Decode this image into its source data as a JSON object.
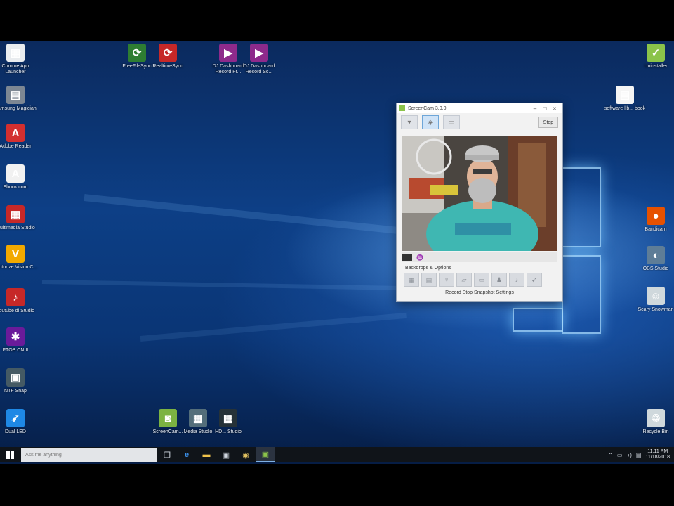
{
  "desktop": {
    "left_icons": [
      {
        "label": "Chrome App Launcher",
        "icon": "app-launcher-icon",
        "color": "#e9ecef"
      },
      {
        "label": "Samsung Magician",
        "icon": "drive-icon",
        "color": "#7d8793"
      },
      {
        "label": "Adobe Reader",
        "icon": "acrobat-icon",
        "color": "#d32f2f"
      },
      {
        "label": "Ebook.com",
        "icon": "pdf-icon",
        "color": "#f1f1f1"
      },
      {
        "label": "Multimedia Studio",
        "icon": "multimedia-icon",
        "color": "#c62828"
      },
      {
        "label": "Vectorize Vision C...",
        "icon": "v-logo-icon",
        "color": "#f2a900"
      },
      {
        "label": "youtube dl Studio",
        "icon": "youtube-icon",
        "color": "#c62828"
      },
      {
        "label": "FTOB CN II",
        "icon": "media-icon",
        "color": "#6a1b9a"
      },
      {
        "label": "NTF Snap",
        "icon": "screen-icon",
        "color": "#455a64"
      },
      {
        "label": "Dual LED",
        "icon": "wing-icon",
        "color": "#1e88e5"
      }
    ],
    "top_icons": [
      {
        "label": "FreeFileSync",
        "icon": "sync-green-icon",
        "color": "#2e7d32"
      },
      {
        "label": "RealtimeSync",
        "icon": "sync-red-icon",
        "color": "#c62828"
      },
      {
        "label": "DJ Dashboard Record Fr...",
        "icon": "video-folder-icon",
        "color": "#8e2a8b"
      },
      {
        "label": "DJ Dashboard Record Sc...",
        "icon": "video-folder-icon",
        "color": "#8e2a8b"
      }
    ],
    "right_icons": [
      {
        "label": "Uninstaller",
        "icon": "uninstall-icon",
        "color": "#8bc34a"
      },
      {
        "label": "software lib... book",
        "icon": "document-icon",
        "color": "#f5f5f5"
      },
      {
        "label": "Bandicam",
        "icon": "bandicam-icon",
        "color": "#e65100"
      },
      {
        "label": "OBS Studio",
        "icon": "globe-icon",
        "color": "#5e7d97"
      },
      {
        "label": "Scary Snowman",
        "icon": "alien-icon",
        "color": "#cfd8dc"
      },
      {
        "label": "Recycle Bin",
        "icon": "recycle-bin-icon",
        "color": "#cfd8dc"
      }
    ],
    "bottom_icons": [
      {
        "label": "ScreenCam...",
        "icon": "camera-green-icon",
        "color": "#7cb342"
      },
      {
        "label": "Media Studio",
        "icon": "clapper-icon",
        "color": "#546e7a"
      },
      {
        "label": "HD... Studio",
        "icon": "clapper-icon",
        "color": "#263238"
      }
    ]
  },
  "app_window": {
    "title": "ScreenCam 3.0.0",
    "stop_label": "Stop",
    "section_label": "Backdrops & Options",
    "status_text": "Record   Stop   Snapshot   Settings"
  },
  "taskbar": {
    "search_placeholder": "Ask me anything",
    "time": "11:11 PM",
    "date": "11/18/2018"
  }
}
